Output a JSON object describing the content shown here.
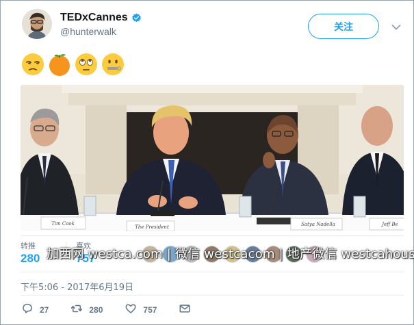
{
  "tweet": {
    "display_name": "TEDxCannes",
    "handle": "@hunterwalk",
    "follow_label": "关注",
    "emojis": [
      "unamused-face-emoji",
      "tangerine-emoji",
      "face-with-rolling-eyes-emoji",
      "zipper-mouth-face-emoji"
    ],
    "photo_placards": [
      "Tim Cook",
      "The President",
      "Satya Nadella",
      "Jeff Be"
    ],
    "stats": {
      "retweets_label": "转推",
      "retweets_value": "280",
      "likes_label": "喜欢",
      "likes_value": "757"
    },
    "watermark": "加西网 westca.com | 微信 westcacom | 地产微信 westcahouse",
    "timestamp": "下午5:06 - 2017年6月19日",
    "actions": {
      "reply_count": "27",
      "retweet_count": "280",
      "like_count": "757"
    }
  },
  "colors": {
    "accent": "#1da1f2",
    "secondary_text": "#657786",
    "border": "#e1e8ed"
  }
}
